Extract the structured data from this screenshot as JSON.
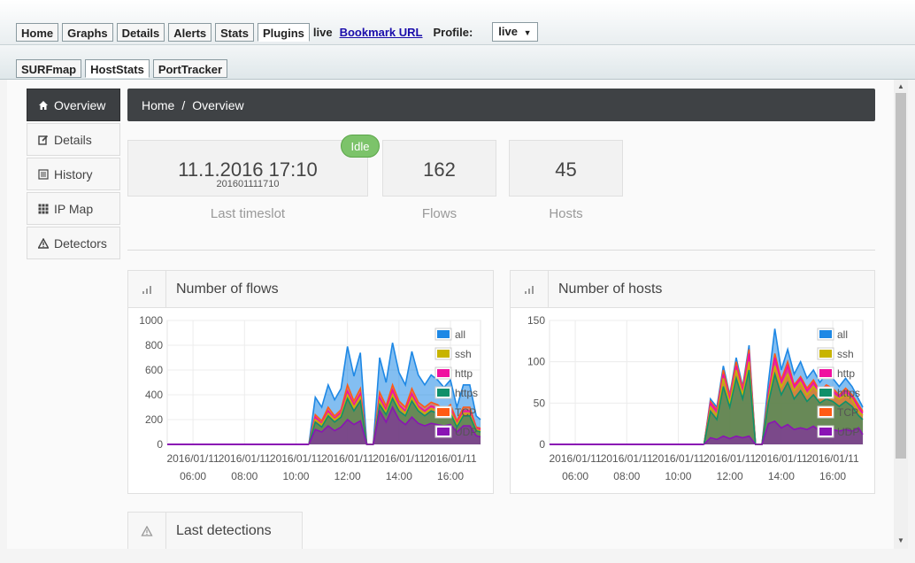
{
  "topbar": {
    "tabs": [
      {
        "label": "Home"
      },
      {
        "label": "Graphs"
      },
      {
        "label": "Details"
      },
      {
        "label": "Alerts"
      },
      {
        "label": "Stats"
      },
      {
        "label": "Plugins"
      }
    ],
    "live_text": "live",
    "bookmark_label": "Bookmark URL",
    "profile_label": "Profile:",
    "profile_value": "live"
  },
  "plugin_tabs": [
    {
      "label": "SURFmap"
    },
    {
      "label": "HostStats"
    },
    {
      "label": "PortTracker"
    }
  ],
  "sidenav": {
    "items": [
      {
        "label": "Overview",
        "icon": "home-icon"
      },
      {
        "label": "Details",
        "icon": "edit-icon"
      },
      {
        "label": "History",
        "icon": "list-icon"
      },
      {
        "label": "IP Map",
        "icon": "grid-icon"
      },
      {
        "label": "Detectors",
        "icon": "warning-icon"
      }
    ]
  },
  "breadcrumb": {
    "home": "Home",
    "separator": "/",
    "current": "Overview"
  },
  "status": {
    "timeslot": "11.1.2016 17:10",
    "timeslot_raw": "201601111710",
    "timeslot_label": "Last timeslot",
    "badge": "Idle",
    "flows": "162",
    "flows_label": "Flows",
    "hosts": "45",
    "hosts_label": "Hosts"
  },
  "last_detections": {
    "title": "Last detections"
  },
  "colors": {
    "all": "#1e88e5",
    "ssh": "#c8b400",
    "http": "#f010a0",
    "https": "#10906a",
    "TCP": "#ff5a14",
    "UDP": "#8a14b4"
  },
  "chart_data": [
    {
      "type": "area",
      "title": "Number of flows",
      "ylim": [
        0,
        1000
      ],
      "yticks": [
        0,
        200,
        400,
        600,
        800,
        1000
      ],
      "xlim": [
        "2016-01-11 05:00",
        "2016-01-11 17:10"
      ],
      "x_tick_labels": [
        {
          "date": "2016/01/11",
          "time": "06:00"
        },
        {
          "date": "2016/01/11",
          "time": "08:00"
        },
        {
          "date": "2016/01/11",
          "time": "10:00"
        },
        {
          "date": "2016/01/11",
          "time": "12:00"
        },
        {
          "date": "2016/01/11",
          "time": "14:00"
        },
        {
          "date": "2016/01/11",
          "time": "16:00"
        }
      ],
      "legend_position": "top-right",
      "grid": true,
      "x": [
        "10:30",
        "10:45",
        "11:00",
        "11:15",
        "11:30",
        "11:45",
        "12:00",
        "12:15",
        "12:30",
        "12:45",
        "13:00",
        "13:15",
        "13:30",
        "13:45",
        "14:00",
        "14:15",
        "14:30",
        "14:45",
        "15:00",
        "15:15",
        "15:30",
        "15:45",
        "16:00",
        "16:15",
        "16:30",
        "16:45",
        "17:00",
        "17:10"
      ],
      "series": [
        {
          "name": "all",
          "values": [
            0,
            380,
            300,
            480,
            360,
            450,
            790,
            550,
            740,
            0,
            0,
            700,
            500,
            820,
            580,
            480,
            750,
            560,
            480,
            560,
            520,
            460,
            520,
            300,
            480,
            480,
            230,
            200
          ]
        },
        {
          "name": "ssh",
          "values": [
            0,
            200,
            160,
            250,
            200,
            240,
            400,
            300,
            380,
            0,
            0,
            350,
            260,
            400,
            300,
            250,
            380,
            290,
            250,
            290,
            270,
            240,
            270,
            160,
            250,
            250,
            120,
            110
          ]
        },
        {
          "name": "http",
          "values": [
            0,
            220,
            170,
            270,
            210,
            260,
            430,
            320,
            410,
            0,
            0,
            380,
            280,
            440,
            320,
            270,
            410,
            310,
            270,
            310,
            290,
            260,
            290,
            170,
            270,
            270,
            130,
            120
          ]
        },
        {
          "name": "https",
          "values": [
            0,
            180,
            140,
            230,
            180,
            220,
            370,
            270,
            350,
            0,
            0,
            320,
            240,
            370,
            270,
            230,
            350,
            270,
            230,
            270,
            250,
            220,
            250,
            140,
            230,
            230,
            110,
            100
          ]
        },
        {
          "name": "TCP",
          "values": [
            0,
            240,
            190,
            300,
            230,
            280,
            480,
            350,
            450,
            0,
            0,
            420,
            310,
            480,
            350,
            300,
            450,
            340,
            300,
            340,
            320,
            280,
            320,
            190,
            300,
            300,
            140,
            130
          ]
        },
        {
          "name": "UDP",
          "values": [
            0,
            120,
            100,
            150,
            110,
            140,
            200,
            160,
            190,
            0,
            0,
            270,
            180,
            300,
            200,
            160,
            220,
            170,
            150,
            170,
            160,
            150,
            160,
            100,
            150,
            150,
            70,
            60
          ]
        }
      ]
    },
    {
      "type": "area",
      "title": "Number of hosts",
      "ylim": [
        0,
        150
      ],
      "yticks": [
        0,
        50,
        100,
        150
      ],
      "xlim": [
        "2016-01-11 05:00",
        "2016-01-11 17:10"
      ],
      "x_tick_labels": [
        {
          "date": "2016/01/11",
          "time": "06:00"
        },
        {
          "date": "2016/01/11",
          "time": "08:00"
        },
        {
          "date": "2016/01/11",
          "time": "10:00"
        },
        {
          "date": "2016/01/11",
          "time": "12:00"
        },
        {
          "date": "2016/01/11",
          "time": "14:00"
        },
        {
          "date": "2016/01/11",
          "time": "16:00"
        }
      ],
      "legend_position": "top-right",
      "grid": true,
      "x": [
        "11:00",
        "11:15",
        "11:30",
        "11:45",
        "12:00",
        "12:15",
        "12:30",
        "12:45",
        "13:00",
        "13:15",
        "13:30",
        "13:45",
        "14:00",
        "14:15",
        "14:30",
        "14:45",
        "15:00",
        "15:15",
        "15:30",
        "15:45",
        "16:00",
        "16:15",
        "16:30",
        "16:45",
        "17:00",
        "17:10"
      ],
      "series": [
        {
          "name": "all",
          "values": [
            0,
            55,
            45,
            95,
            60,
            105,
            70,
            120,
            0,
            0,
            75,
            140,
            90,
            115,
            85,
            100,
            80,
            90,
            75,
            85,
            80,
            70,
            80,
            70,
            55,
            45
          ]
        },
        {
          "name": "ssh",
          "values": [
            0,
            45,
            35,
            80,
            50,
            90,
            60,
            100,
            0,
            0,
            55,
            95,
            70,
            85,
            65,
            75,
            60,
            70,
            60,
            65,
            60,
            55,
            60,
            55,
            40,
            35
          ]
        },
        {
          "name": "http",
          "values": [
            0,
            50,
            40,
            85,
            55,
            95,
            65,
            110,
            0,
            0,
            60,
            105,
            75,
            95,
            70,
            80,
            65,
            75,
            62,
            70,
            65,
            58,
            65,
            58,
            45,
            38
          ]
        },
        {
          "name": "https",
          "values": [
            0,
            40,
            30,
            70,
            45,
            80,
            55,
            90,
            0,
            0,
            50,
            85,
            60,
            75,
            55,
            65,
            52,
            60,
            50,
            55,
            52,
            46,
            52,
            46,
            35,
            30
          ]
        },
        {
          "name": "TCP",
          "values": [
            0,
            52,
            42,
            90,
            58,
            100,
            68,
            115,
            0,
            0,
            62,
            110,
            78,
            100,
            72,
            82,
            68,
            78,
            64,
            72,
            68,
            60,
            68,
            60,
            48,
            40
          ]
        },
        {
          "name": "UDP",
          "values": [
            0,
            8,
            6,
            10,
            7,
            10,
            8,
            10,
            0,
            0,
            25,
            28,
            20,
            24,
            18,
            20,
            18,
            22,
            16,
            18,
            18,
            16,
            18,
            16,
            20,
            12
          ]
        }
      ]
    }
  ]
}
